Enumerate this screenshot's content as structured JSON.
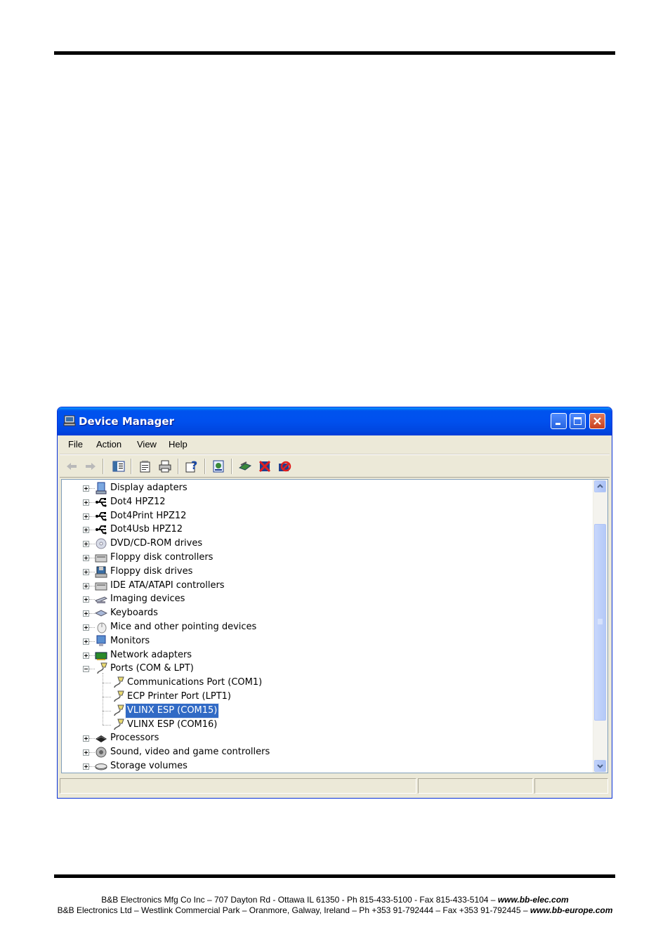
{
  "window": {
    "title": "Device Manager",
    "title_color": "#0050ee"
  },
  "menu": [
    "File",
    "Action",
    "View",
    "Help"
  ],
  "toolbar_icons": [
    "back-arrow-icon",
    "forward-arrow-icon",
    "show-hide-console-tree-icon",
    "properties-icon",
    "print-icon",
    "help-icon",
    "scan-hardware-icon",
    "update-driver-icon",
    "uninstall-icon",
    "disable-icon"
  ],
  "tree": [
    {
      "label": "Display adapters",
      "icon": "display-adapter-icon",
      "level": 0,
      "expander": "plus"
    },
    {
      "label": "Dot4 HPZ12",
      "icon": "usb-icon",
      "level": 0,
      "expander": "plus"
    },
    {
      "label": "Dot4Print HPZ12",
      "icon": "usb-icon",
      "level": 0,
      "expander": "plus"
    },
    {
      "label": "Dot4Usb HPZ12",
      "icon": "usb-icon",
      "level": 0,
      "expander": "plus"
    },
    {
      "label": "DVD/CD-ROM drives",
      "icon": "cd-drive-icon",
      "level": 0,
      "expander": "plus"
    },
    {
      "label": "Floppy disk controllers",
      "icon": "controller-icon",
      "level": 0,
      "expander": "plus"
    },
    {
      "label": "Floppy disk drives",
      "icon": "floppy-icon",
      "level": 0,
      "expander": "plus"
    },
    {
      "label": "IDE ATA/ATAPI controllers",
      "icon": "controller-icon",
      "level": 0,
      "expander": "plus"
    },
    {
      "label": "Imaging devices",
      "icon": "scanner-icon",
      "level": 0,
      "expander": "plus"
    },
    {
      "label": "Keyboards",
      "icon": "keyboard-icon",
      "level": 0,
      "expander": "plus"
    },
    {
      "label": "Mice and other pointing devices",
      "icon": "mouse-icon",
      "level": 0,
      "expander": "plus"
    },
    {
      "label": "Monitors",
      "icon": "monitor-icon",
      "level": 0,
      "expander": "plus"
    },
    {
      "label": "Network adapters",
      "icon": "network-card-icon",
      "level": 0,
      "expander": "plus"
    },
    {
      "label": "Ports (COM & LPT)",
      "icon": "port-icon",
      "level": 0,
      "expander": "minus"
    },
    {
      "label": "Communications Port (COM1)",
      "icon": "port-icon",
      "level": 1,
      "expander": "none"
    },
    {
      "label": "ECP Printer Port (LPT1)",
      "icon": "port-icon",
      "level": 1,
      "expander": "none"
    },
    {
      "label": "VLINX ESP (COM15)",
      "icon": "port-icon",
      "level": 1,
      "expander": "none",
      "selected": true
    },
    {
      "label": "VLINX ESP (COM16)",
      "icon": "port-icon",
      "level": 1,
      "expander": "none"
    },
    {
      "label": "Processors",
      "icon": "processor-icon",
      "level": 0,
      "expander": "plus"
    },
    {
      "label": "Sound, video and game controllers",
      "icon": "sound-icon",
      "level": 0,
      "expander": "plus"
    },
    {
      "label": "Storage volumes",
      "icon": "storage-icon",
      "level": 0,
      "expander": "plus"
    }
  ],
  "footer": {
    "line1_text": "B&B Electronics Mfg Co Inc – 707 Dayton Rd - Ottawa IL 61350 - Ph 815-433-5100 - Fax 815-433-5104 – ",
    "line1_url": "www.bb-elec.com",
    "line2_text": "B&B Electronics Ltd – Westlink Commercial Park – Oranmore, Galway, Ireland – Ph +353 91-792444 – Fax +353 91-792445 – ",
    "line2_url": "www.bb-europe.com"
  }
}
